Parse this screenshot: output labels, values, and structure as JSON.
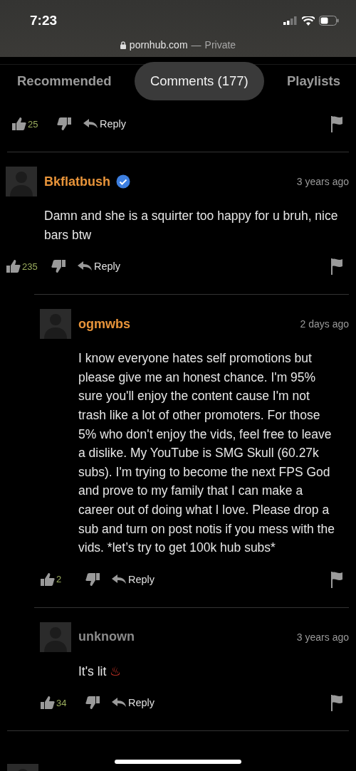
{
  "status_bar": {
    "time": "7:23"
  },
  "address_bar": {
    "domain": "pornhub.com",
    "separator": "—",
    "mode": "Private"
  },
  "tabs": [
    {
      "label": "Recommended",
      "selected": false
    },
    {
      "label": "Comments (177)",
      "selected": true
    },
    {
      "label": "Playlists",
      "selected": false
    }
  ],
  "previous_comment_actions": {
    "likes": "25",
    "reply": "Reply"
  },
  "comments": [
    {
      "user": "Bkflatbush",
      "color": "#e8943a",
      "verified": true,
      "time": "3 years ago",
      "text": "Damn and she is a squirter too happy for u bruh, nice bars btw",
      "likes": "235",
      "reply": "Reply",
      "children": [
        {
          "user": "ogmwbs",
          "color": "#e8943a",
          "verified": false,
          "time": "2 days ago",
          "text": "I know everyone hates self promotions but please give me an honest chance. I'm 95% sure you'll enjoy the content cause I'm not trash like a lot of other promoters. For those 5% who don't enjoy the vids, feel free to leave a dislike. My YouTube is SMG Skull (60.27k subs). I'm trying to become the next FPS God and prove to my family that I can make a career out of doing what I love. Please drop a sub and turn on post notis if you mess with the vids. *let’s try to get 100k hub subs*",
          "likes": "2",
          "reply": "Reply"
        },
        {
          "user": "unknown",
          "color": "#8a8a8a",
          "verified": false,
          "time": "3 years ago",
          "text": "It's lit",
          "emoji": "♨",
          "likes": "34",
          "reply": "Reply"
        }
      ]
    }
  ]
}
